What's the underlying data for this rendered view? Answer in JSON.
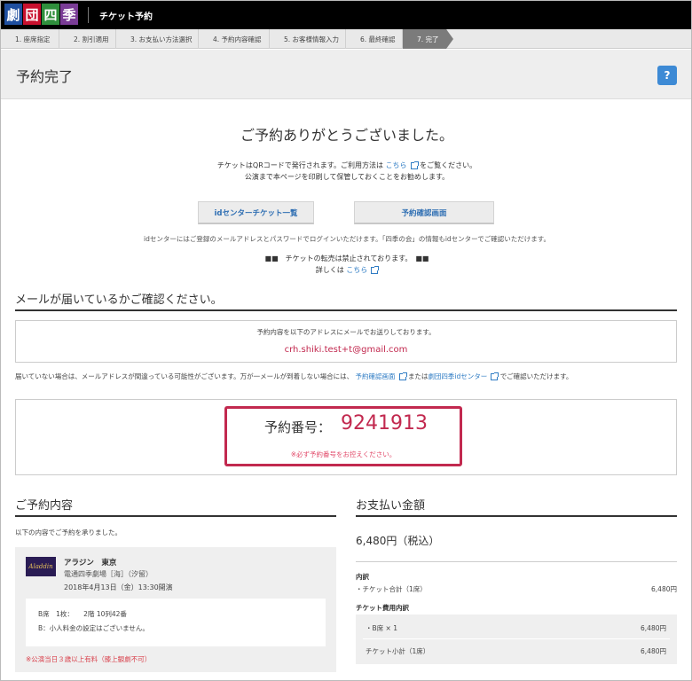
{
  "header": {
    "logo_chars": [
      "劇",
      "団",
      "四",
      "季"
    ],
    "app_name": "チケット予約"
  },
  "steps": [
    "1. 座席指定",
    "2. 割引適用",
    "3. お支払い方法選択",
    "4. 予約内容確認",
    "5. お客様情報入力",
    "6. 最終確認",
    "7. 完了"
  ],
  "active_step": 7,
  "page": {
    "title": "予約完了",
    "help_label": "?"
  },
  "thanks": "ご予約ありがとうございました。",
  "ticket_note": {
    "line1_before": "チケットはQRコードで発行されます。ご利用方法は",
    "line1_link": "こちら",
    "line1_after": "をご覧ください。",
    "line2": "公演まで本ページを印刷して保管しておくことをお勧めします。"
  },
  "buttons": {
    "id_center": "idセンターチケット一覧",
    "reservation_check": "予約確認画面"
  },
  "id_note": "idセンターにはご登録のメールアドレスとパスワードでログインいただけます。「四季の会」の情報もidセンターでご確認いただけます。",
  "resale_note": {
    "line1": "■■　チケットの転売は禁止されております。　■■",
    "line2_before": "詳しくは",
    "line2_link": "こちら"
  },
  "mail_section": {
    "heading": "メールが届いているかご確認ください。",
    "note": "予約内容を以下のアドレスにメールでお送りしております。",
    "address": "crh.shiki.test+t@gmail.com",
    "warning_before": "届いていない場合は、メールアドレスが間違っている可能性がございます。万が一メールが到着しない場合には、",
    "warning_link1": "予約確認画面",
    "warning_mid": "または",
    "warning_link2": "劇団四季idセンター",
    "warning_after": "でご確認いただけます。"
  },
  "reservation_number": {
    "label": "予約番号：",
    "value": "9241913",
    "note": "※必ず予約番号をお控えください。"
  },
  "reservation": {
    "heading": "ご予約内容",
    "note": "以下の内容でご予約を承りました。",
    "poster_label": "Aladdin",
    "show": "アラジン　東京",
    "venue": "電通四季劇場［海］（汐留）",
    "datetime": "2018年4月13日（金）13:30開演",
    "seat_line1": "B席　1枚：　　2階 10列42番",
    "seat_line2": "B：小人料金の設定はございません。",
    "warning": "※公演当日３歳以上有料（膝上観劇不可）"
  },
  "payment": {
    "heading": "お支払い金額",
    "total": "6,480円（税込）",
    "detail_heading": "内訳",
    "ticket_total_label": "・チケット合計（1席）",
    "ticket_total_value": "6,480円",
    "fee_heading": "チケット費用内訳",
    "fee1_label": "・B席 × 1",
    "fee1_value": "6,480円",
    "fee2_label": "チケット小計（1席）",
    "fee2_value": "6,480円"
  }
}
